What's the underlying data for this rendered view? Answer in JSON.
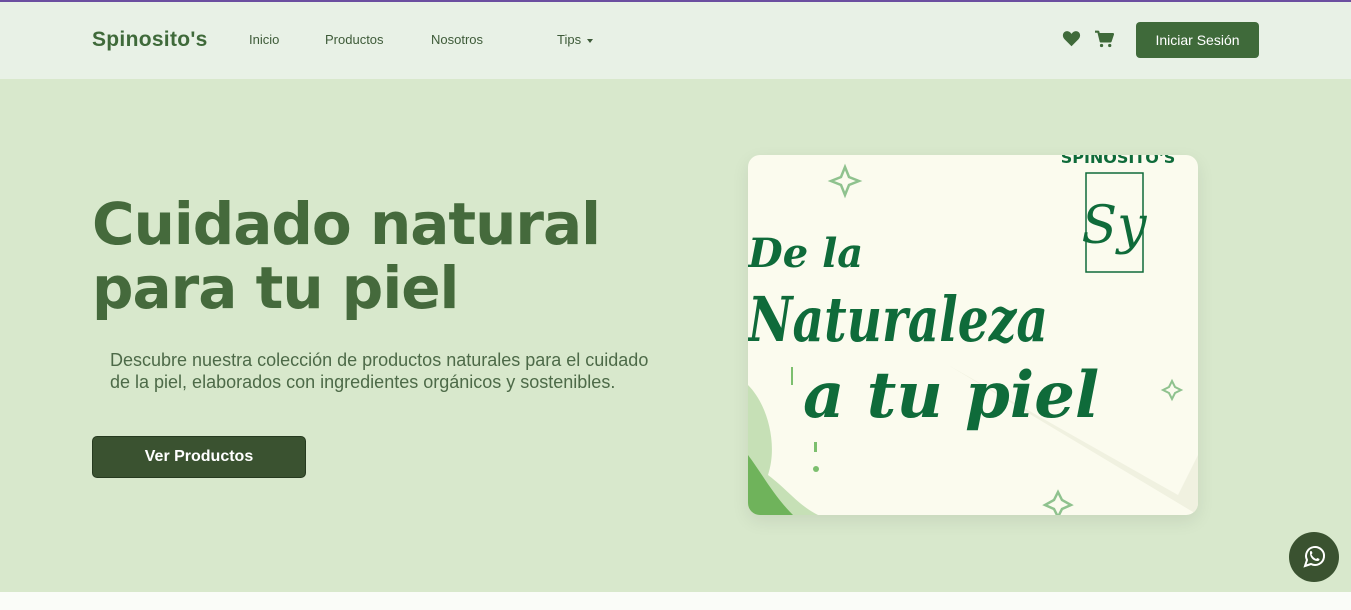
{
  "navbar": {
    "brand": "Spinosito's",
    "links": [
      {
        "label": "Inicio"
      },
      {
        "label": "Productos"
      },
      {
        "label": "Nosotros"
      },
      {
        "label": "Tips"
      }
    ],
    "login_label": "Iniciar Sesión",
    "icons": [
      "heart-icon",
      "cart-icon"
    ]
  },
  "hero": {
    "title_line1": "Cuidado natural",
    "title_line2": "para tu piel",
    "description": "Descubre nuestra colección de productos naturales para el cuidado de la piel, elaborados con ingredientes orgánicos y sostenibles.",
    "cta_label": "Ver Productos"
  },
  "banner": {
    "brand_text": "SPINOSITO'S",
    "monogram": "Sy",
    "line1": "De la",
    "line2": "Naturaleza",
    "line3": "a tu piel"
  },
  "colors": {
    "primary": "#3f6a3a",
    "hero_bg": "#d8e8cc",
    "navbar_bg": "#e8f1e6",
    "banner_text": "#0f6b3a"
  },
  "floating": {
    "icon": "whatsapp-icon"
  }
}
